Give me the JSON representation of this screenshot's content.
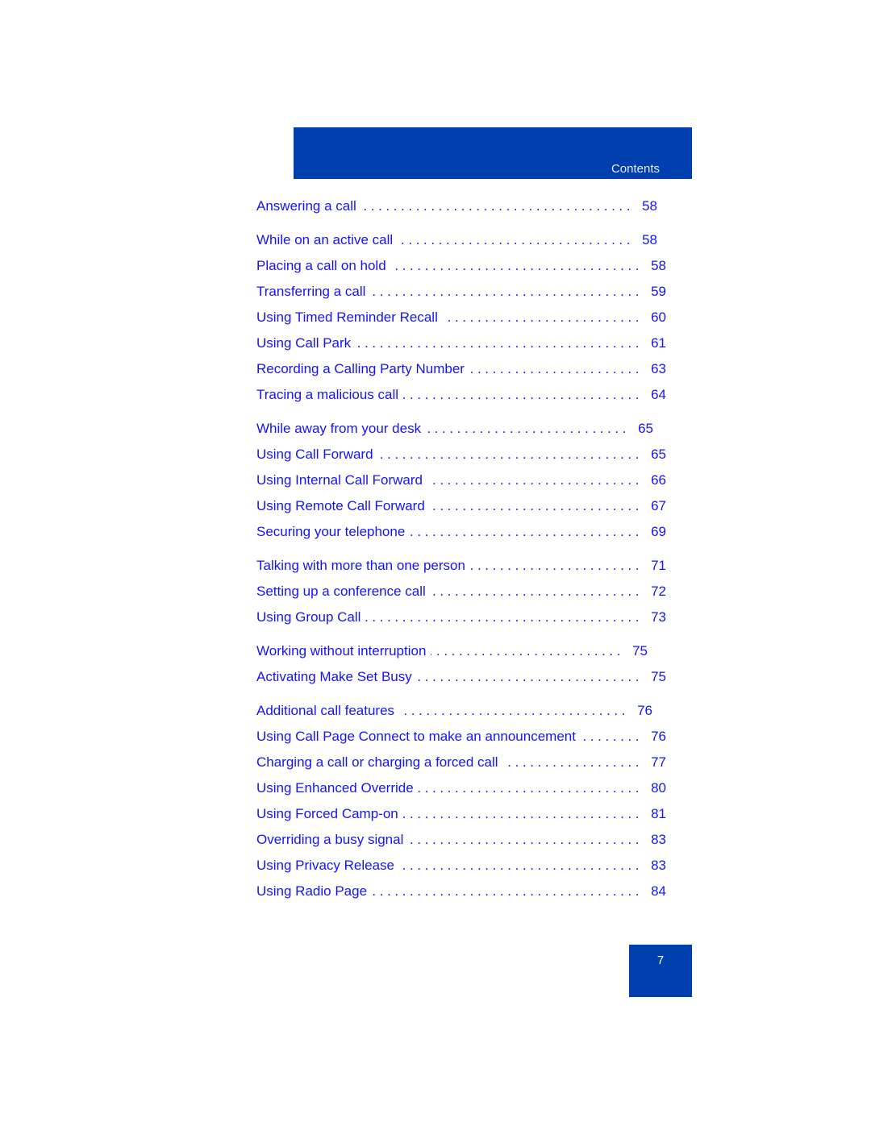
{
  "header": {
    "title": "Contents"
  },
  "toc": [
    {
      "label": "Answering a call",
      "page": "58",
      "heading": true
    },
    {
      "label": "While on an active call",
      "page": "58",
      "heading": true
    },
    {
      "label": "Placing a call on hold",
      "page": "58"
    },
    {
      "label": "Transferring a call",
      "page": "59"
    },
    {
      "label": "Using Timed Reminder Recall",
      "page": "60"
    },
    {
      "label": "Using Call Park",
      "page": "61"
    },
    {
      "label": "Recording a Calling Party Number",
      "page": "63"
    },
    {
      "label": "Tracing a malicious call",
      "page": "64"
    },
    {
      "label": "While away from your desk",
      "page": "65",
      "heading": true
    },
    {
      "label": "Using Call Forward",
      "page": "65"
    },
    {
      "label": "Using Internal Call Forward",
      "page": "66"
    },
    {
      "label": "Using Remote Call Forward",
      "page": "67"
    },
    {
      "label": "Securing your telephone",
      "page": "69"
    },
    {
      "label": "Talking with more than one person",
      "page": "71"
    },
    {
      "label": "Setting up a conference call",
      "page": "72"
    },
    {
      "label": "Using Group Call",
      "page": "73"
    },
    {
      "label": "Working without interruption",
      "page": "75",
      "heading": true
    },
    {
      "label": "Activating Make Set Busy",
      "page": "75"
    },
    {
      "label": "Additional call features",
      "page": "76",
      "heading": true
    },
    {
      "label": "Using Call Page Connect to make an announcement",
      "page": "76"
    },
    {
      "label": "Charging a call or charging a forced call",
      "page": "77"
    },
    {
      "label": "Using Enhanced Override",
      "page": "80"
    },
    {
      "label": "Using Forced Camp-on",
      "page": "81"
    },
    {
      "label": "Overriding a busy signal",
      "page": "83"
    },
    {
      "label": "Using Privacy Release",
      "page": "83"
    },
    {
      "label": "Using Radio Page",
      "page": "84"
    }
  ],
  "footer": {
    "page_number": "7"
  }
}
